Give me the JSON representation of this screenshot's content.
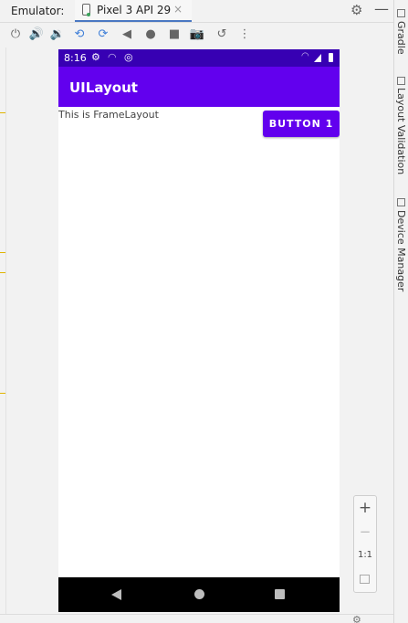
{
  "window": {
    "emulator_label": "Emulator:",
    "tab_label": "Pixel 3 API 29",
    "tab_close": "×",
    "gear_icon": "⚙",
    "minimize_icon": "—"
  },
  "toolbar": {
    "icons": [
      {
        "name": "power-icon",
        "glyph": "⏻"
      },
      {
        "name": "volume-up-icon",
        "glyph": "🔊"
      },
      {
        "name": "volume-down-icon",
        "glyph": "🔉"
      },
      {
        "name": "rotate-left-icon",
        "glyph": "⟲"
      },
      {
        "name": "rotate-right-icon",
        "glyph": "⟳"
      },
      {
        "name": "back-icon",
        "glyph": "◀"
      },
      {
        "name": "home-icon",
        "glyph": "●"
      },
      {
        "name": "overview-icon",
        "glyph": "■"
      },
      {
        "name": "camera-icon",
        "glyph": "📷"
      },
      {
        "name": "snapshot-icon",
        "glyph": "↺"
      },
      {
        "name": "more-icon",
        "glyph": "⋮"
      }
    ]
  },
  "right_tabs": {
    "gradle": "Gradle",
    "layout_validation": "Layout Validation",
    "device_manager": "Device Manager"
  },
  "device": {
    "status_time": "8:16",
    "app_title": "UILayout",
    "frame_text": "This is FrameLayout",
    "button_label": "BUTTON 1",
    "colors": {
      "status_bar": "#3700b3",
      "app_bar": "#6200ee",
      "button": "#6200ee",
      "nav_bar": "#000000"
    }
  },
  "zoom": {
    "zoom_in": "+",
    "zoom_out": "−",
    "actual_size": "1:1"
  }
}
